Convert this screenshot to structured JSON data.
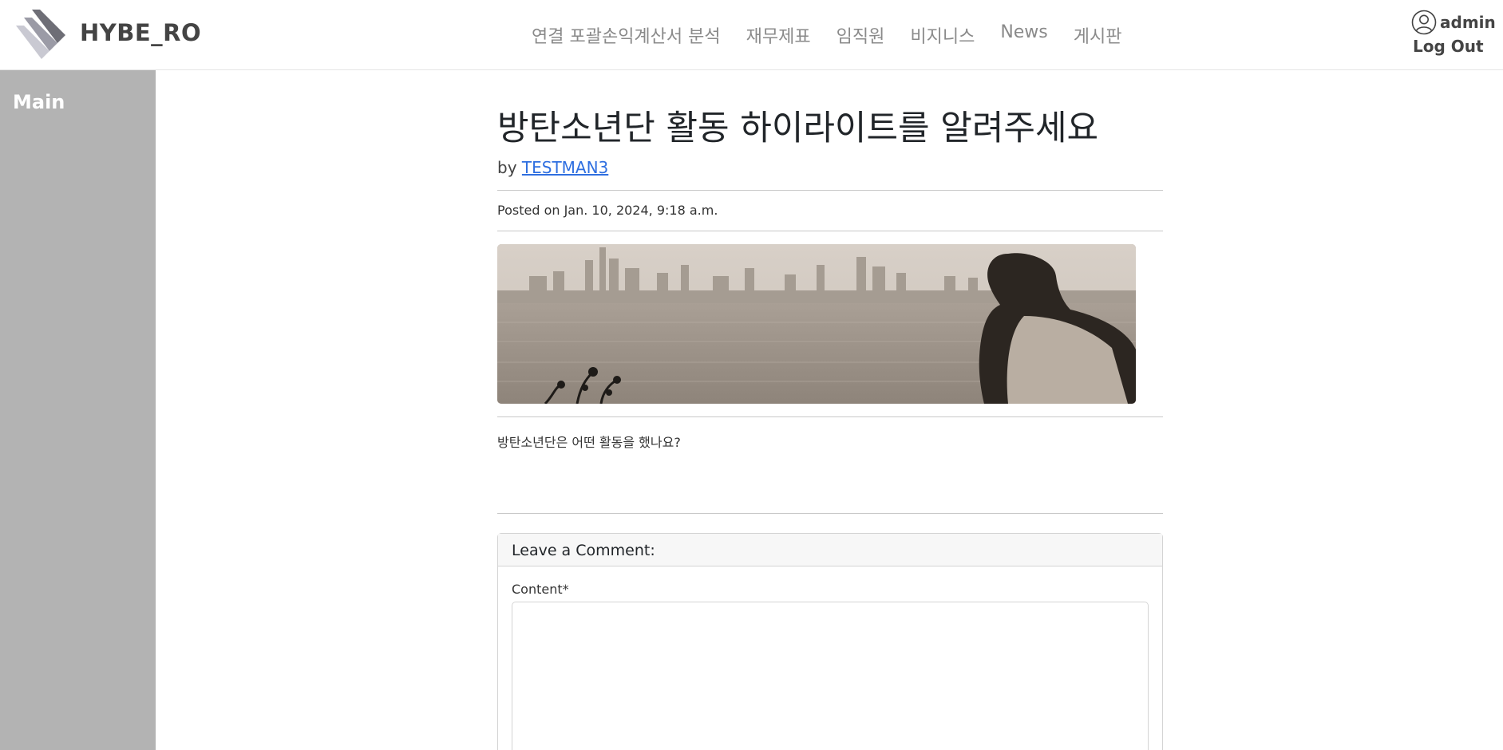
{
  "header": {
    "brand": "HYBE_RO",
    "nav": [
      {
        "label": "연결 포괄손익계산서 분석"
      },
      {
        "label": "재무제표"
      },
      {
        "label": "임직원"
      },
      {
        "label": "비지니스"
      },
      {
        "label": "News"
      },
      {
        "label": "게시판"
      }
    ],
    "user": {
      "name": "admin",
      "logout_label": "Log Out"
    }
  },
  "sidebar": {
    "title": "Main"
  },
  "post": {
    "title": "방탄소년단 활동 하이라이트를 알려주세요",
    "by_prefix": "by",
    "author": "TESTMAN3",
    "posted": "Posted on Jan. 10, 2024, 9:18 a.m.",
    "body": "방탄소년단은 어떤 활동을 했나요?"
  },
  "comment": {
    "header": "Leave a Comment:",
    "label": "Content*",
    "value": ""
  },
  "colors": {
    "sidebar_bg": "#b3b3b3",
    "link": "#2f6fe0",
    "nav_text": "#8a8a8a"
  },
  "icons": [
    "logo-stripes-icon",
    "user-circle-icon"
  ]
}
